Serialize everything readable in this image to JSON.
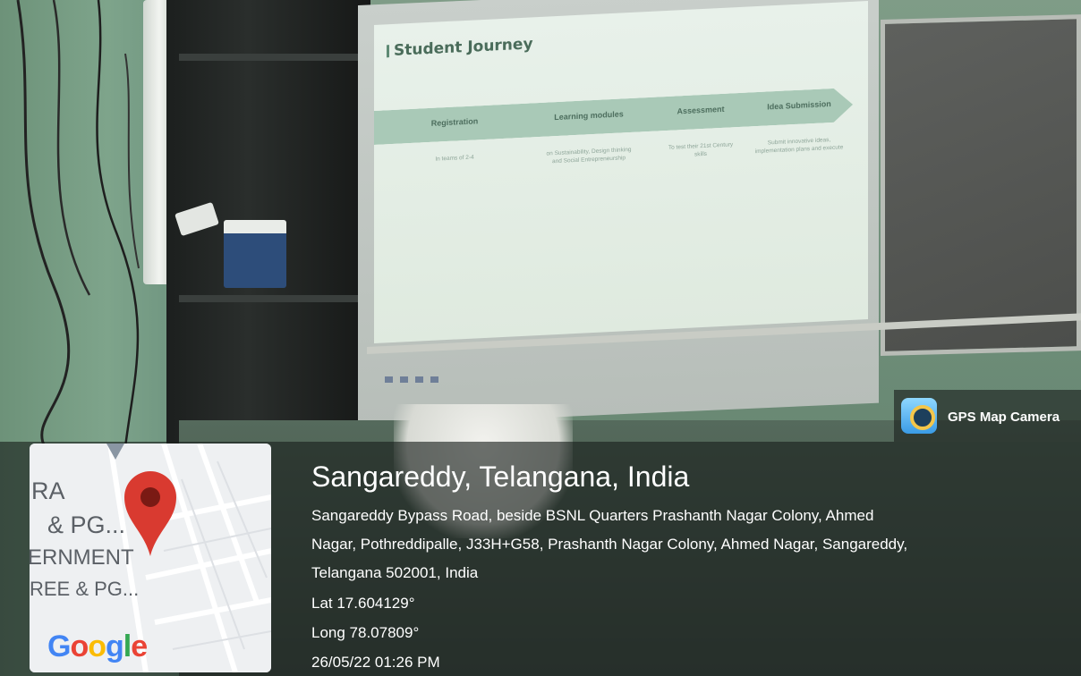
{
  "slide": {
    "title": "Student Journey",
    "stages": [
      {
        "label": "Registration",
        "desc": "In teams of 2-4"
      },
      {
        "label": "Learning modules",
        "desc": "on Sustainability, Design thinking and Social Entrepreneurship"
      },
      {
        "label": "Assessment",
        "desc": "To test their 21st Century skills"
      },
      {
        "label": "Idea Submission",
        "desc": "Submit innovative ideas, implementation plans and execute"
      }
    ]
  },
  "gps_badge": {
    "app_name": "GPS Map Camera",
    "icon": "gps-map-camera-icon"
  },
  "map": {
    "labels": [
      "RA",
      "& PG...",
      "ERNMENT",
      "REE & PG..."
    ],
    "logo_text": "Google",
    "pin_icon": "map-pin-icon",
    "colors": {
      "pin": "#d93a30",
      "google_blue": "#4285F4",
      "google_red": "#EA4335",
      "google_yellow": "#FBBC05",
      "google_green": "#34A853"
    }
  },
  "location": {
    "title": "Sangareddy, Telangana, India",
    "address_lines": [
      "Sangareddy Bypass Road, beside BSNL Quarters Prashanth Nagar Colony, Ahmed",
      "Nagar, Pothreddipalle, J33H+G58, Prashanth Nagar Colony, Ahmed Nagar, Sangareddy,",
      "Telangana 502001, India"
    ],
    "lat": "Lat 17.604129°",
    "long": "Long 78.07809°",
    "datetime": "26/05/22 01:26 PM"
  }
}
